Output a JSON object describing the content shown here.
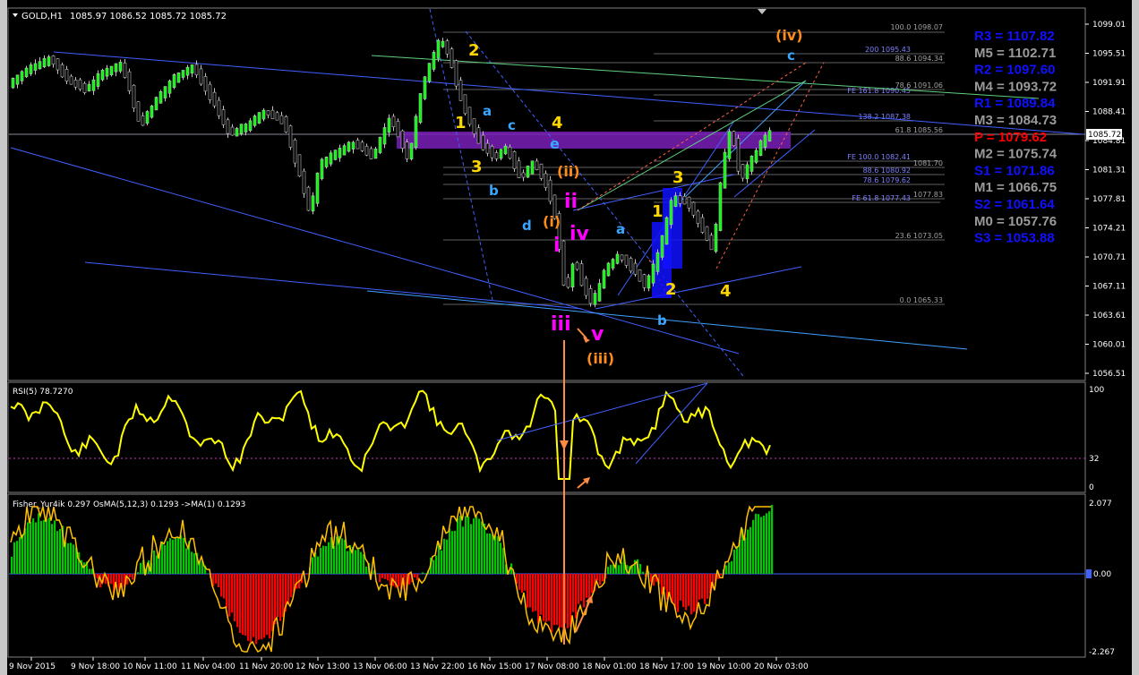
{
  "header": {
    "symbol": "GOLD,H1",
    "ohlc": "1085.97 1086.52 1085.72 1085.72"
  },
  "price_axis": {
    "ticks": [
      "1099.01",
      "1095.51",
      "1091.91",
      "1088.41",
      "1084.81",
      "1081.31",
      "1077.81",
      "1074.21",
      "1070.71",
      "1067.11",
      "1063.61",
      "1060.01",
      "1056.51"
    ],
    "current": "1085.72"
  },
  "fib_levels": [
    {
      "label": "100.0 1098.07"
    },
    {
      "label": "200 1095.43"
    },
    {
      "label": "88.6 1094.34"
    },
    {
      "label": "78.6 1091.06"
    },
    {
      "label": "FE 161.8 1090.45"
    },
    {
      "label": "138.2 1087.38"
    },
    {
      "label": "61.8 1085.56"
    },
    {
      "label": "FE 100.0 1082.41"
    },
    {
      "label": "1081.70"
    },
    {
      "label": "88.6 1080.92"
    },
    {
      "label": "78.6 1079.62"
    },
    {
      "label": "FE 61.8 1077.43"
    },
    {
      "label": "1077.83"
    },
    {
      "label": "23.6 1073.05"
    },
    {
      "label": "0.0 1065.33"
    }
  ],
  "pivots": [
    {
      "label": "R3 = 1107.82",
      "color": "#1010ff"
    },
    {
      "label": "M5 = 1102.71",
      "color": "#9a9a9a"
    },
    {
      "label": "R2 = 1097.60",
      "color": "#1010ff"
    },
    {
      "label": "M4 = 1093.72",
      "color": "#9a9a9a"
    },
    {
      "label": "R1 = 1089.84",
      "color": "#1010ff"
    },
    {
      "label": "M3 = 1084.73",
      "color": "#9a9a9a"
    },
    {
      "label": "P = 1079.62",
      "color": "#ff0000"
    },
    {
      "label": "M2 = 1075.74",
      "color": "#9a9a9a"
    },
    {
      "label": "S1 = 1071.86",
      "color": "#1010ff"
    },
    {
      "label": "M1 = 1066.75",
      "color": "#9a9a9a"
    },
    {
      "label": "S2 = 1061.64",
      "color": "#1010ff"
    },
    {
      "label": "M0 = 1057.76",
      "color": "#9a9a9a"
    },
    {
      "label": "S3 = 1053.88",
      "color": "#1010ff"
    }
  ],
  "wave_labels": [
    {
      "text": "2",
      "color": "#ffd700"
    },
    {
      "text": "1",
      "color": "#ffd700"
    },
    {
      "text": "a",
      "color": "#3aa6ff"
    },
    {
      "text": "c",
      "color": "#3aa6ff"
    },
    {
      "text": "4",
      "color": "#ffd700"
    },
    {
      "text": "e",
      "color": "#3aa6ff"
    },
    {
      "text": "3",
      "color": "#ffd700"
    },
    {
      "text": "(ii)",
      "color": "#ff8c1a"
    },
    {
      "text": "b",
      "color": "#3aa6ff"
    },
    {
      "text": "ii",
      "color": "#ff00ff"
    },
    {
      "text": "d",
      "color": "#3aa6ff"
    },
    {
      "text": "(i)",
      "color": "#ff8c1a"
    },
    {
      "text": "iv",
      "color": "#ff00ff"
    },
    {
      "text": "i",
      "color": "#ff00ff"
    },
    {
      "text": "a",
      "color": "#3aa6ff"
    },
    {
      "text": "iii",
      "color": "#ff00ff"
    },
    {
      "text": "v",
      "color": "#ff00ff"
    },
    {
      "text": "(iii)",
      "color": "#ff8c1a"
    },
    {
      "text": "b",
      "color": "#3aa6ff"
    },
    {
      "text": "1",
      "color": "#ffd700"
    },
    {
      "text": "3",
      "color": "#ffd700"
    },
    {
      "text": "2",
      "color": "#ffd700"
    },
    {
      "text": "4",
      "color": "#ffd700"
    },
    {
      "text": "(iv)",
      "color": "#ff8c1a"
    },
    {
      "text": "c",
      "color": "#3aa6ff"
    }
  ],
  "rsi": {
    "label": "RSI(5) 78.7270",
    "ticks": [
      "100",
      "32",
      "0"
    ]
  },
  "fisher": {
    "label": "Fisher_Yur4ik 0.297  OsMA(5,12,3) 0.1293  ->MA(1) 0.1293",
    "ticks": [
      "2.077",
      "0.00",
      "-2.267"
    ]
  },
  "time_axis": [
    "9 Nov 2015",
    "9 Nov 18:00",
    "10 Nov 11:00",
    "11 Nov 04:00",
    "11 Nov 20:00",
    "12 Nov 13:00",
    "13 Nov 06:00",
    "13 Nov 22:00",
    "16 Nov 15:00",
    "17 Nov 08:00",
    "18 Nov 01:00",
    "18 Nov 17:00",
    "19 Nov 10:00",
    "20 Nov 03:00"
  ],
  "colors": {
    "bull": "#00c800",
    "bear": "#ff0000",
    "rsi": "#ffff00",
    "grid": "#505050",
    "box": "#7a1fb8",
    "trend": "#4060ff"
  }
}
